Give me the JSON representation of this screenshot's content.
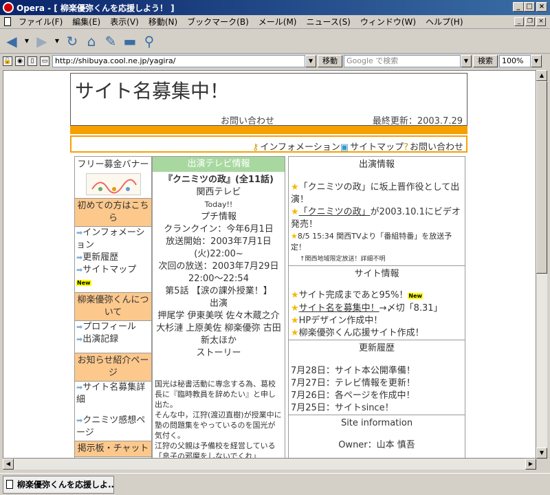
{
  "window": {
    "title": "Opera - [ 柳楽優弥くんを応援しよう！ ]"
  },
  "menu": [
    "ファイル(F)",
    "編集(E)",
    "表示(V)",
    "移動(N)",
    "ブックマーク(B)",
    "メール(M)",
    "ニュース(S)",
    "ウィンドウ(W)",
    "ヘルプ(H)"
  ],
  "address": {
    "url": "http://shibuya.cool.ne.jp/yagira/",
    "go_label": "移動",
    "search_placeholder": "Google で検索",
    "search_label": "検索",
    "zoom": "100%"
  },
  "status": {
    "tab_title": "柳楽優弥くんを応援しよ..."
  },
  "page": {
    "site_name": "サイト名募集中！",
    "contact": "お問い合わせ",
    "last_updated": "最終更新：2003.7.29",
    "nav": [
      "インフォメーション",
      "サイトマップ",
      "お問い合わせ"
    ],
    "left": {
      "banner_label": "フリー募金バナー",
      "sec1": "初めての方はこちら",
      "sec1_items": [
        "インフォメーション",
        "更新履歴",
        "サイトマップ"
      ],
      "sec1_new": "New",
      "sec2": "柳楽優弥くんについて",
      "sec2_items": [
        "プロフィール",
        "出演記録"
      ],
      "sec3": "お知らせ紹介ページ",
      "sec3_items": [
        "サイト名募集詳細",
        "クニミツ感想ページ"
      ],
      "sec4": "掲示板・チャット"
    },
    "mid": {
      "head": "出演テレビ情報",
      "title": "『クニミツの政』(全11話)",
      "station": "関西テレビ",
      "today": "Today!!",
      "petit": "プチ情報",
      "crankin": "クランクイン：今年6月1日",
      "broadcast": "放送開始：2003年7月1日(火)22:00~",
      "next": "次回の放送：2003年7月29日 22:00～22:54",
      "episode": "第5話 【涙の課外授業！】",
      "cast_label": "出演",
      "cast": "押尾学 伊東美咲 佐々木蔵之介 大杉漣 上原美佐 柳楽優弥 古田新太ほか",
      "story_label": "ストーリー",
      "story": [
        "国光は秘書活動に専念する為、葛校長に『臨時教員を辞めたい』と申し出た。",
        "そんな中，江狩(渡辺直樹)が授業中に塾の問題集をやっているのを国光が気付く。",
        "江狩の父親は予備校を経営している",
        "「息子の邪魔をしないでくれ」"
      ]
    },
    "right": {
      "h1": "出演情報",
      "i1": "「クニミツの政」に坂上晋作役として出演！",
      "i2a": "「クニミツの政」",
      "i2b": "が2003.10.1にビデオ発売！",
      "i3": "8/5 15:34 関西TVより「番組特番」を放送予定！",
      "i3note": "↑関西地域限定放送！詳細不明",
      "h2": "サイト情報",
      "s1": "サイト完成まであと95%！",
      "s1new": "New",
      "s2a": "サイト名を募集中！",
      "s2b": "→〆切「8.31」",
      "s3": "HPデザイン作成中！",
      "s4": "柳楽優弥くん応援サイト作成！",
      "h3": "更新履歴",
      "u": [
        "7月28日：サイト本公開準備！",
        "7月27日：テレビ情報を更新！",
        "7月26日：各ページを作成中！",
        "7月25日：サイトsince！"
      ],
      "h4": "Site information",
      "owner": "Owner：山本 慎吾"
    }
  },
  "colors": {
    "accent": "#f5a000",
    "green": "#a8d8a0",
    "orange_light": "#fcc88c",
    "titlebar": "#0a246a"
  }
}
